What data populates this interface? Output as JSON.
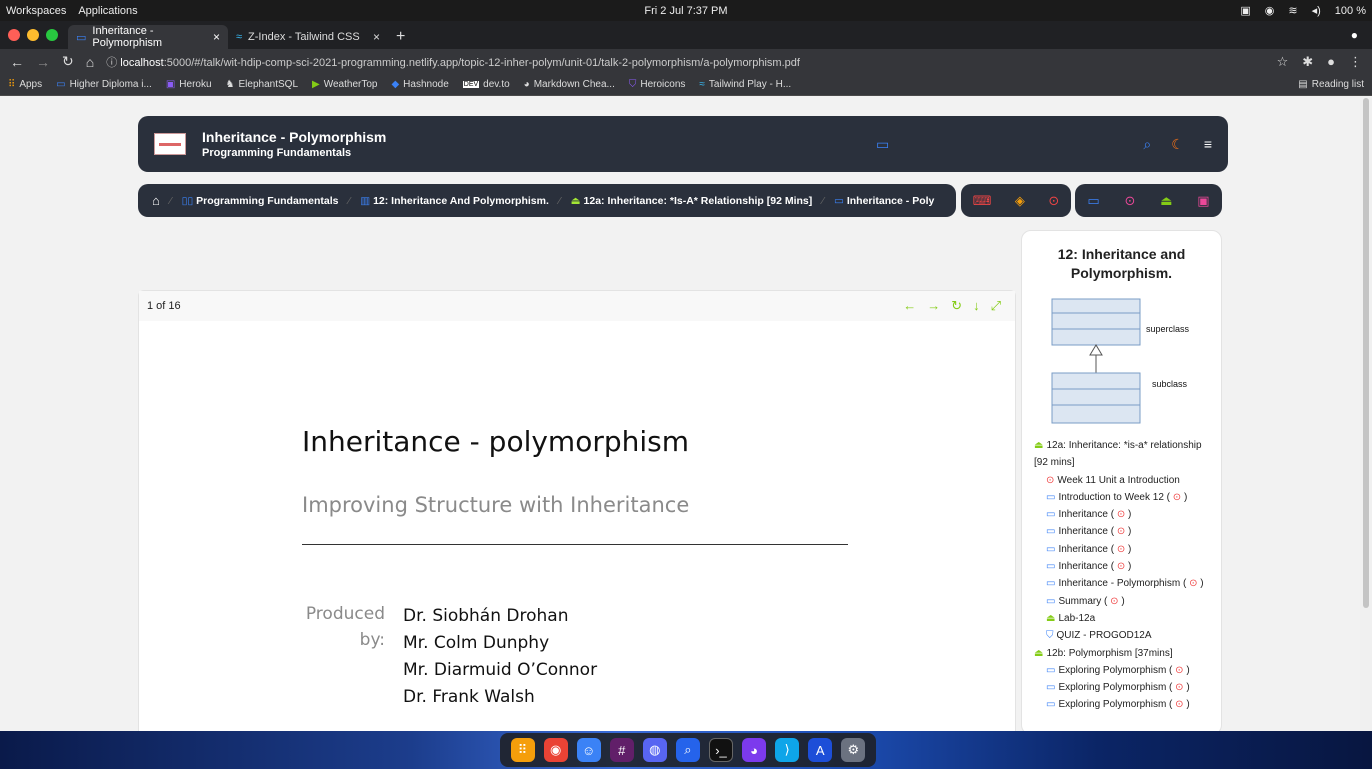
{
  "topbar": {
    "workspaces": "Workspaces",
    "applications": "Applications",
    "clock": "Fri 2 Jul  7:37 PM",
    "battery": "100 %"
  },
  "tabs": [
    {
      "label": "Inheritance - Polymorphism",
      "close": "×"
    },
    {
      "label": "Z-Index - Tailwind CSS",
      "close": "×"
    }
  ],
  "newtab": "+",
  "urlbar": {
    "host": "localhost",
    "rest": ":5000/#/talk/wit-hdip-comp-sci-2021-programming.netlify.app/topic-12-inher-polym/unit-01/talk-2-polymorphism/a-polymorphism.pdf"
  },
  "bookmarks": [
    {
      "label": "Apps",
      "icon": "apps-grid-icon"
    },
    {
      "label": "Higher Diploma i...",
      "icon": "slides-icon"
    },
    {
      "label": "Heroku",
      "icon": "heroku-icon"
    },
    {
      "label": "ElephantSQL",
      "icon": "elephant-icon"
    },
    {
      "label": "WeatherTop",
      "icon": "play-icon"
    },
    {
      "label": "Hashnode",
      "icon": "hashnode-icon"
    },
    {
      "label": "dev.to",
      "icon": "devto-icon"
    },
    {
      "label": "Markdown Chea...",
      "icon": "github-icon"
    },
    {
      "label": "Heroicons",
      "icon": "shield-icon"
    },
    {
      "label": "Tailwind Play - H...",
      "icon": "tailwind-icon"
    }
  ],
  "reading_list": "Reading list",
  "header": {
    "title": "Inheritance - Polymorphism",
    "subtitle": "Programming Fundamentals"
  },
  "breadcrumbs": [
    {
      "label": "Programming Fundamentals"
    },
    {
      "label": "12: Inheritance And Polymorphism."
    },
    {
      "label": "12a: Inheritance: *Is-A* Relationship [92 Mins]"
    },
    {
      "label": "Inheritance - Poly"
    }
  ],
  "viewer": {
    "page_indicator": "1 of 16"
  },
  "slide": {
    "title": "Inheritance - polymorphism",
    "subtitle": "Improving Structure with Inheritance",
    "produced": "Produced",
    "by": "by:",
    "authors": [
      "Dr. Siobhán Drohan",
      "Mr. Colm Dunphy",
      "Mr. Diarmuid O’Connor",
      "Dr. Frank Walsh"
    ]
  },
  "side": {
    "title": "12: Inheritance and Polymorphism.",
    "uml_superclass": "superclass",
    "uml_subclass": "subclass",
    "items": [
      {
        "label": "12a: Inheritance: *is-a* relationship [92 mins]",
        "level": 1,
        "icon": "beaker-icon"
      },
      {
        "label": "Week 11 Unit a Introduction",
        "level": 2,
        "icon": "video-icon"
      },
      {
        "label": "Introduction to Week 12 (",
        "level": 2,
        "icon": "slides-icon",
        "tail": ")"
      },
      {
        "label": "Inheritance (",
        "level": 2,
        "icon": "slides-icon",
        "tail": ")"
      },
      {
        "label": "Inheritance (",
        "level": 2,
        "icon": "slides-icon",
        "tail": ")"
      },
      {
        "label": "Inheritance (",
        "level": 2,
        "icon": "slides-icon",
        "tail": ")"
      },
      {
        "label": "Inheritance (",
        "level": 2,
        "icon": "slides-icon",
        "tail": ")"
      },
      {
        "label": "Inheritance - Polymorphism (",
        "level": 2,
        "icon": "slides-icon",
        "tail": ")"
      },
      {
        "label": "Summary (",
        "level": 2,
        "icon": "slides-icon",
        "tail": ")"
      },
      {
        "label": "Lab-12a",
        "level": 2,
        "icon": "beaker-icon"
      },
      {
        "label": "QUIZ - PROGOD12A",
        "level": 2,
        "icon": "bookmark-icon"
      },
      {
        "label": "12b: Polymorphism [37mins]",
        "level": 1,
        "icon": "beaker-icon"
      },
      {
        "label": "Exploring Polymorphism (",
        "level": 2,
        "icon": "slides-icon",
        "tail": ")"
      },
      {
        "label": "Exploring Polymorphism (",
        "level": 2,
        "icon": "slides-icon",
        "tail": ")"
      },
      {
        "label": "Exploring Polymorphism (",
        "level": 2,
        "icon": "slides-icon",
        "tail": ")"
      }
    ]
  },
  "colors": {
    "nav_bg": "#2a303c",
    "accent_blue": "#3b82f6",
    "accent_green": "#84cc16",
    "accent_red": "#ef4444",
    "accent_yellow": "#f59e0b"
  }
}
